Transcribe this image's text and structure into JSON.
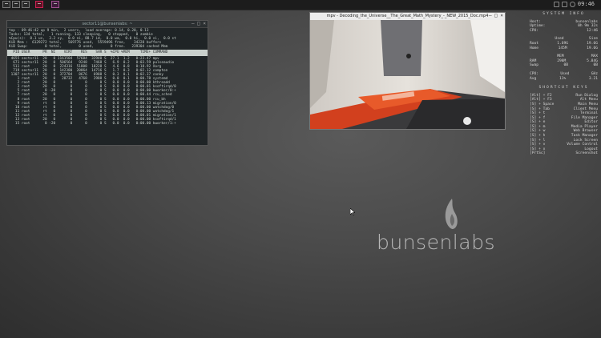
{
  "panel": {
    "launchers": [
      "terminal-icon",
      "file-manager-icon",
      "terminal-icon",
      "window-icon",
      "media-icon"
    ],
    "clock": "09:46"
  },
  "terminal": {
    "title": "sector11@bunsenlabs: ~",
    "header_lines": [
      "top - 09:46:42 up 9 min,  2 users,  load average: 0.14, 0.20, 0.13",
      "Tasks: 134 total,   1 running, 133 sleeping,   0 stopped,   0 zombie",
      "%Cpu(s):  8.1 us,  3.2 sy,  0.0 ni, 88.7 id,  0.0 wa,  0.0 hi,  0.0 si,  0.0 st",
      "KiB Mem :  6129272 total,   569776 used,  5559496 free,    34228 buffers",
      "KiB Swap:        0 total,        0 used,        0 free.   239304 cached Mem"
    ],
    "table_header": "  PID USER      PR  NI    VIRT    RES    SHR S  %CPU %MEM     TIME+ COMMAND",
    "rows": [
      " 4655 sector11  20   0 1161504  57684  32940 S  27.1  1.2   0:23.47 mpv",
      "  671 sector11  20   0  506564   9248   7468 S   6.9  0.2   0:03.59 pulseaudio",
      "  511 root      20   0  224316  51808  18228 S   4.6  0.8   0:18.92 Xorg",
      "  719 sector11  20   0  142380  20864  14716 S   1.7  0.3   0:02.12 compton",
      " 1307 sector11  20   0  372784   8676   6988 S   0.3  0.1   0:02.37 conky",
      "    1 root      20   0   28732   4768   2988 S   0.0  0.1   0:00.78 systemd",
      "    2 root      20   0       0      0      0 S   0.0  0.0   0:00.00 kthreadd",
      "    3 root      20   0       0      0      0 S   0.0  0.0   0:00.01 ksoftirqd/0",
      "    5 root       0 -20       0      0      0 S   0.0  0.0   0:00.00 kworker/0:+",
      "    7 root      20   0       0      0      0 S   0.0  0.0   0:00.44 rcu_sched",
      "    8 root      20   0       0      0      0 S   0.0  0.0   0:00.00 rcu_bh",
      "    9 root      rt   0       0      0      0 S   0.0  0.0   0:00.13 migration/0",
      "   10 root      rt   0       0      0      0 S   0.0  0.0   0:00.00 watchdog/0",
      "   11 root      rt   0       0      0      0 S   0.0  0.0   0:00.00 watchdog/1",
      "   12 root      rt   0       0      0      0 S   0.0  0.0   0:00.01 migration/1",
      "   13 root      20   0       0      0      0 S   0.0  0.0   0:00.00 ksoftirqd/1",
      "   15 root       0 -20       0      0      0 S   0.0  0.0   0:00.00 kworker/1:+"
    ]
  },
  "mpv": {
    "title": "mpv - Decoding_the_Universe__The_Great_Math_Mystery_-_NEW_2015_Doc.mp4"
  },
  "conky": {
    "system_title": "SYSTEM INFO",
    "host_label": "Host:",
    "host_value": "bunsenlabs",
    "uptime_label": "Uptime:",
    "uptime_value": "0h 9m 32s",
    "cpu_clock_label": "CPU:",
    "cpu_clock_value": "12:46",
    "used_label": "Used",
    "size_label": "Size",
    "root_label": "Root",
    "root_used": "1.69G",
    "root_size": "19.6G",
    "home_label": "Home",
    "home_used": "145M",
    "home_size": "19.6G",
    "mem_label": "MEM",
    "max_label": "MAX",
    "ram_label": "RAM",
    "ram_used": "298M",
    "ram_max": "5.84G",
    "swap_label": "Swap",
    "swap_used": "0B",
    "swap_max": "0B",
    "cpu_label": "CPU:",
    "cpu_used_label": "Used",
    "ghz_label": "GHz",
    "avg_label": "Avg",
    "avg_value": "11%",
    "avg_ghz": "3.21",
    "shortcut_title": "SHORTCUT KEYS",
    "shortcuts": [
      [
        "[Alt] + F2",
        "Run Dialog"
      ],
      [
        "[Alt] + F3",
        "Alt Menu"
      ],
      [
        "[S] + Space",
        "Main Menu"
      ],
      [
        "[S] + Tab",
        "Client Menu"
      ],
      [
        "[S] + t",
        "Terminal"
      ],
      [
        "[S] + f",
        "File Manager"
      ],
      [
        "[S] + e",
        "Editor"
      ],
      [
        "[S] + m",
        "Media Player"
      ],
      [
        "[S] + w",
        "Web Browser"
      ],
      [
        "[S] + h",
        "Task Manager"
      ],
      [
        "[S] + l",
        "Lock Screen"
      ],
      [
        "[S] + v",
        "Volume Control"
      ],
      [
        "[S] + x",
        "Logout"
      ],
      [
        "[PrtSc]",
        "Screenshot"
      ]
    ]
  },
  "logo": {
    "text": "bunsenlabs"
  }
}
